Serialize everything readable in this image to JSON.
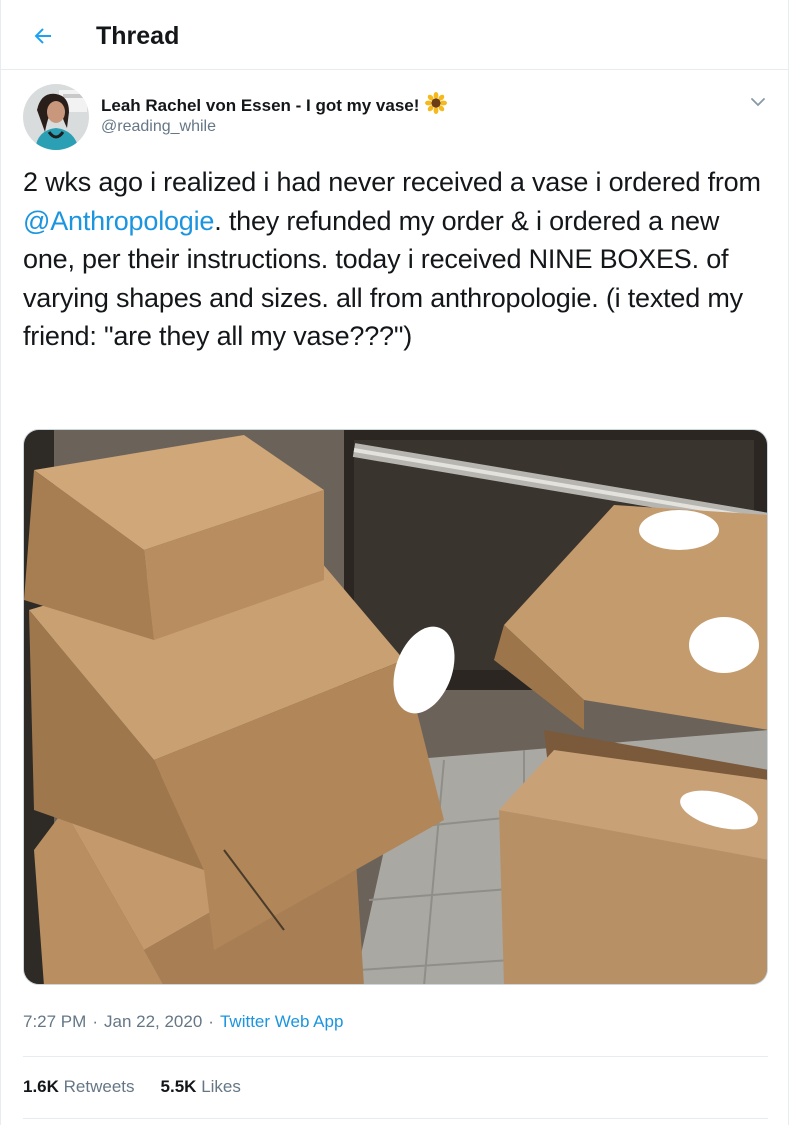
{
  "header": {
    "back_icon": "arrow-left-icon",
    "title": "Thread"
  },
  "author": {
    "name": "Leah Rachel von Essen - I got my vase!",
    "emoji": "🌻",
    "handle": "@reading_while"
  },
  "tweet": {
    "text_before": "2 wks ago i realized i had never received a vase i ordered from ",
    "mention": "@Anthropologie",
    "text_after": ". they refunded my order & i ordered a new one, per their instructions. today i received NINE BOXES. of varying shapes and sizes. all from anthropologie. (i texted my friend: \"are they all my vase???\")"
  },
  "meta": {
    "time": "7:27 PM",
    "sep1": "·",
    "date": "Jan 22, 2020",
    "sep2": "·",
    "source": "Twitter Web App"
  },
  "stats": {
    "retweets_count": "1.6K",
    "retweets_label": "Retweets",
    "likes_count": "5.5K",
    "likes_label": "Likes"
  },
  "colors": {
    "accent": "#1da1f2",
    "link": "#1b95e0",
    "secondary_text": "#657786"
  }
}
